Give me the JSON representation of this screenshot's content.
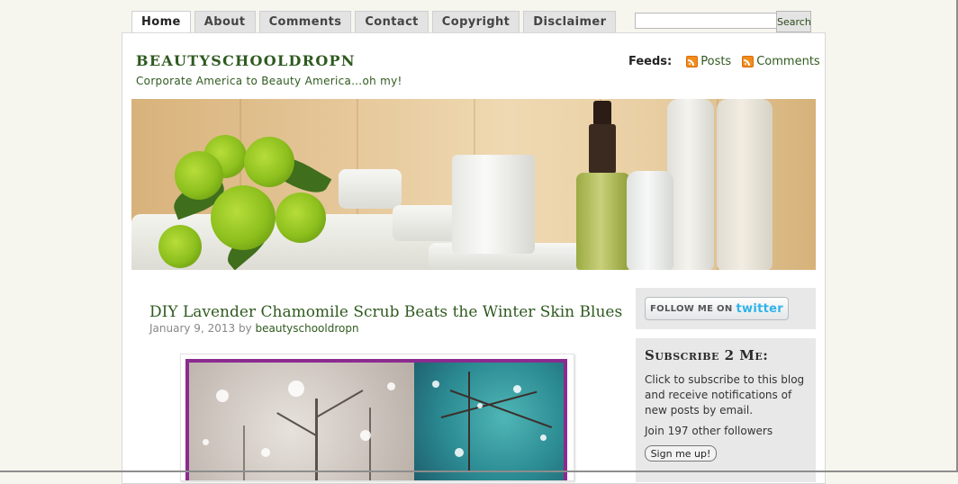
{
  "nav": {
    "tabs": [
      {
        "label": "Home",
        "active": true
      },
      {
        "label": "About"
      },
      {
        "label": "Comments"
      },
      {
        "label": "Contact"
      },
      {
        "label": "Copyright"
      },
      {
        "label": "Disclaimer"
      }
    ]
  },
  "search": {
    "value": "",
    "button_label": "Search"
  },
  "header": {
    "site_title": "BEAUTYSCHOOLDROPN",
    "tagline": "Corporate America to Beauty America…oh my!",
    "feeds_label": "Feeds:",
    "feed_posts": "Posts",
    "feed_comments": "Comments"
  },
  "post": {
    "title": "DIY Lavender Chamomile Scrub Beats the Winter Skin Blues",
    "date": "January 9, 2013",
    "by": "by",
    "author": "beautyschooldropn"
  },
  "sidebar": {
    "follow_text": "FOLLOW ME ON",
    "follow_brand": "twitter",
    "subscribe_heading": "Subscribe 2 Me:",
    "subscribe_text": "Click to subscribe to this blog and receive notifications of new posts by email.",
    "followers_text": "Join 197 other followers",
    "signup_label": "Sign me up!"
  },
  "colors": {
    "accent": "#2f5a1f",
    "page_bg": "#f6f6ef",
    "twitter_blue": "#2fb4e8",
    "image_frame": "#8c2b8f"
  },
  "icons": [
    "rss-feed-icon",
    "twitter-logo"
  ]
}
